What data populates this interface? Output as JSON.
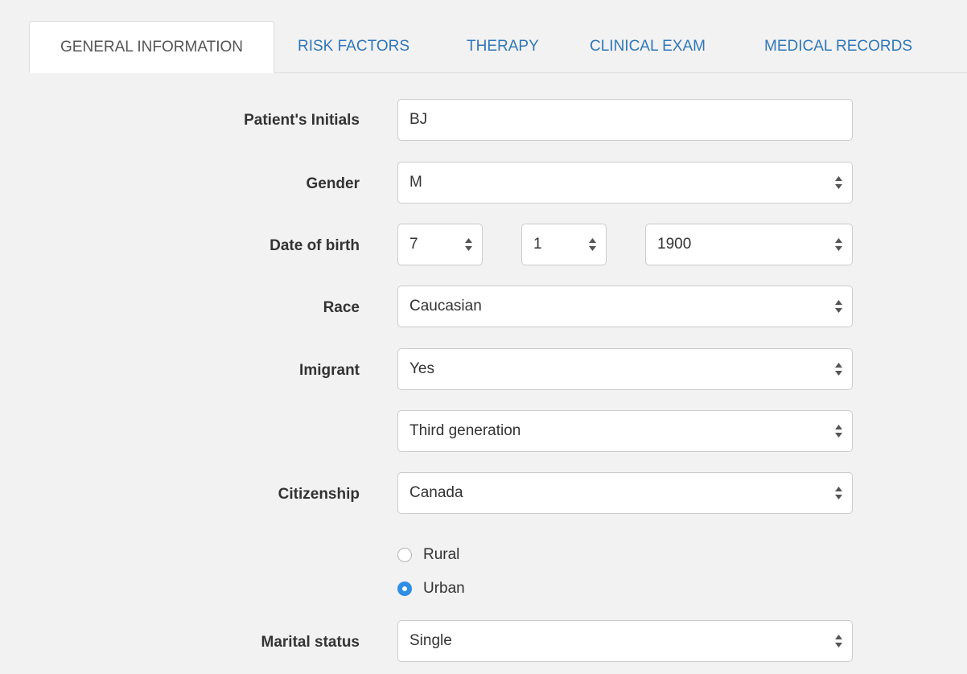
{
  "tabs": [
    {
      "label": "GENERAL INFORMATION",
      "active": true
    },
    {
      "label": "RISK FACTORS",
      "active": false
    },
    {
      "label": "THERAPY",
      "active": false
    },
    {
      "label": "CLINICAL EXAM",
      "active": false
    },
    {
      "label": "MEDICAL RECORDS",
      "active": false
    }
  ],
  "form": {
    "initials": {
      "label": "Patient's Initials",
      "value": "BJ"
    },
    "gender": {
      "label": "Gender",
      "value": "M"
    },
    "dob": {
      "label": "Date of birth",
      "month": "7",
      "day": "1",
      "year": "1900"
    },
    "race": {
      "label": "Race",
      "value": "Caucasian"
    },
    "immigrant": {
      "label": "Imigrant",
      "value": "Yes",
      "generation": "Third generation"
    },
    "citizenship": {
      "label": "Citizenship",
      "value": "Canada"
    },
    "residence": {
      "options": [
        {
          "label": "Rural",
          "checked": false
        },
        {
          "label": "Urban",
          "checked": true
        }
      ]
    },
    "marital": {
      "label": "Marital status",
      "value": "Single"
    }
  },
  "colors": {
    "background": "#f2f2f2",
    "tab_link": "#2f77b8",
    "tab_active_text": "#555555",
    "radio_checked": "#2f8ee5",
    "border": "#cccccc"
  },
  "icons": {
    "select_arrows": "updown-arrows-icon"
  }
}
